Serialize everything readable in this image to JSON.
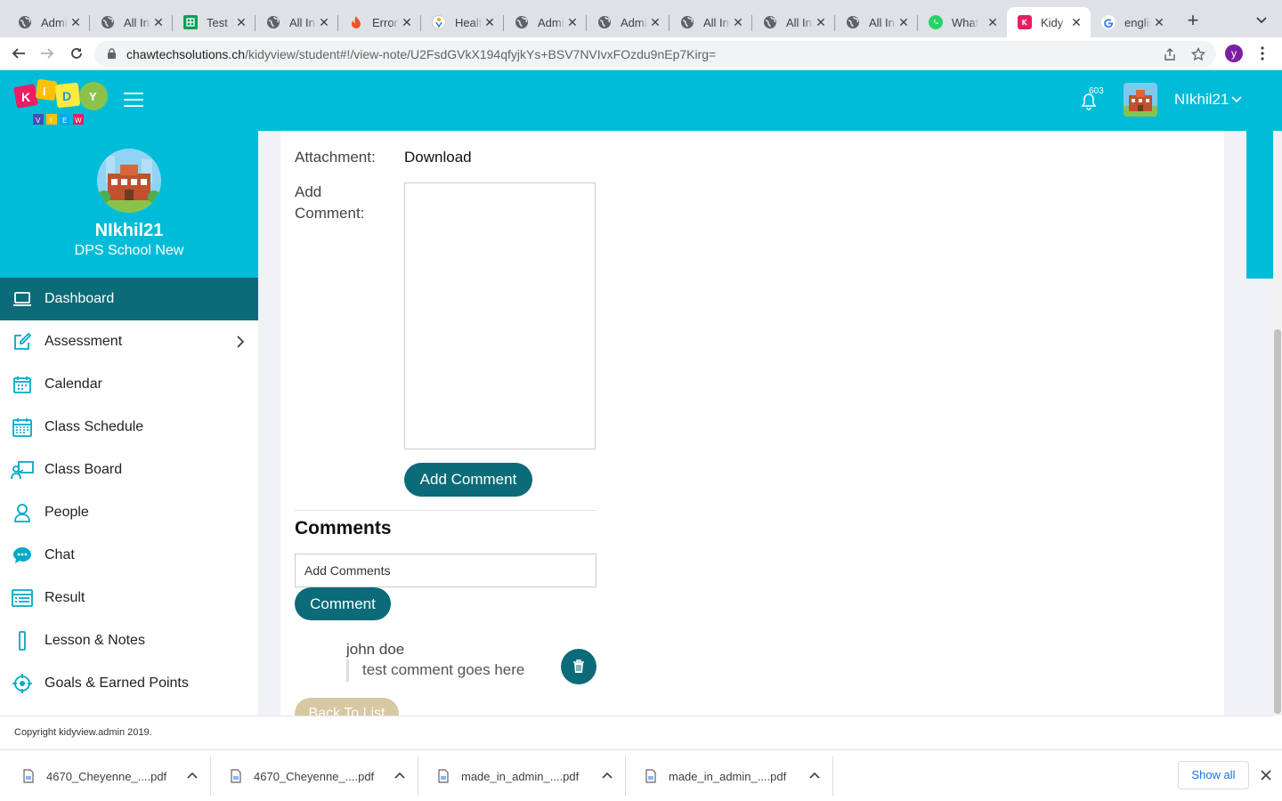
{
  "browser": {
    "tabs": [
      {
        "title": "Admin",
        "favicon": "globe-icon"
      },
      {
        "title": "All Ins",
        "favicon": "globe-icon"
      },
      {
        "title": "Test S",
        "favicon": "sheets-icon"
      },
      {
        "title": "All Ins",
        "favicon": "globe-icon"
      },
      {
        "title": "Error",
        "favicon": "fire-icon"
      },
      {
        "title": "Health",
        "favicon": "health-icon"
      },
      {
        "title": "Admin",
        "favicon": "globe-icon"
      },
      {
        "title": "Admin",
        "favicon": "globe-icon"
      },
      {
        "title": "All Ins",
        "favicon": "globe-icon"
      },
      {
        "title": "All Ins",
        "favicon": "globe-icon"
      },
      {
        "title": "All Ins",
        "favicon": "globe-icon"
      },
      {
        "title": "What",
        "favicon": "whatsapp-icon"
      },
      {
        "title": "Kidy",
        "favicon": "kidy-icon",
        "active": true
      },
      {
        "title": "englis",
        "favicon": "google-icon"
      }
    ],
    "url_host": "chawtechsolutions.ch",
    "url_path": "/kidyview/student#!/view-note/U2FsdGVkX194qfyjkYs+BSV7NVIvxFOzdu9nEp7Kirg=",
    "profile_initial": "y"
  },
  "header": {
    "notification_count": "603",
    "username": "NIkhil21"
  },
  "sidebar": {
    "name": "NIkhil21",
    "school": "DPS School New",
    "items": [
      {
        "label": "Dashboard",
        "icon": "laptop-icon",
        "active": true
      },
      {
        "label": "Assessment",
        "icon": "edit-icon",
        "has_submenu": true
      },
      {
        "label": "Calendar",
        "icon": "calendar-icon"
      },
      {
        "label": "Class Schedule",
        "icon": "schedule-icon"
      },
      {
        "label": "Class Board",
        "icon": "class-board-icon"
      },
      {
        "label": "People",
        "icon": "person-icon"
      },
      {
        "label": "Chat",
        "icon": "chat-icon"
      },
      {
        "label": "Result",
        "icon": "result-icon"
      },
      {
        "label": "Lesson & Notes",
        "icon": "lesson-icon"
      },
      {
        "label": "Goals & Earned Points",
        "icon": "target-icon"
      }
    ]
  },
  "note": {
    "attachment_label": "Attachment:",
    "attachment_link": "Download",
    "add_comment_label": "Add Comment:",
    "add_comment_value": "",
    "add_comment_button": "Add Comment"
  },
  "comments": {
    "title": "Comments",
    "input_placeholder": "Add Comments",
    "submit_button": "Comment",
    "list": [
      {
        "author": "john doe",
        "text": "test comment goes here"
      }
    ],
    "back_button": "Back To List"
  },
  "footer": {
    "copyright": "Copyright kidyview.admin 2019."
  },
  "downloads": {
    "files": [
      "4670_Cheyenne_....pdf",
      "4670_Cheyenne_....pdf",
      "made_in_admin_....pdf",
      "made_in_admin_....pdf"
    ],
    "show_all": "Show all"
  },
  "colors": {
    "brand_cyan": "#00bcd8",
    "teal_dark": "#0b6b78",
    "back_button": "#d8c8a4"
  }
}
